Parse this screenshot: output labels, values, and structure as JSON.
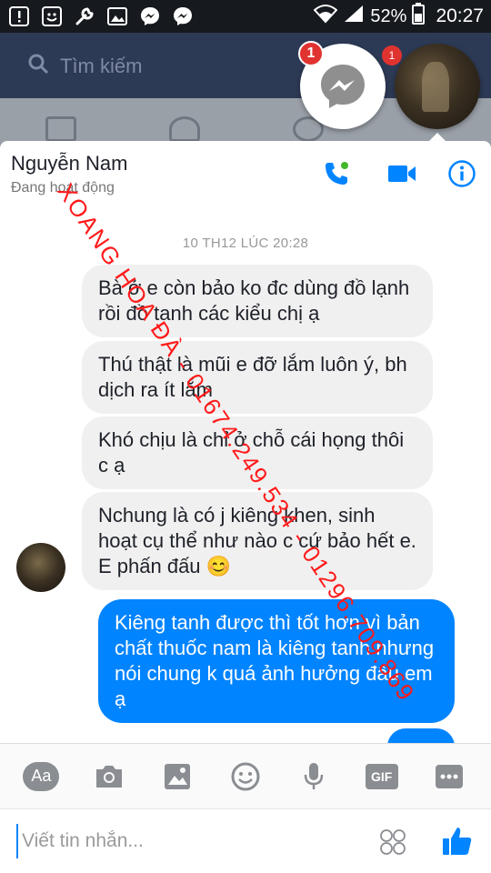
{
  "status_bar": {
    "battery": "52%",
    "time": "20:27"
  },
  "facebook": {
    "search_placeholder": "Tìm kiếm"
  },
  "chat_heads": {
    "messenger_badge": "1",
    "second_badge": "1"
  },
  "chat": {
    "contact_name": "Nguyễn Nam",
    "contact_status": "Đang hoạt động",
    "timestamp": "10 TH12 LÚC 20:28",
    "messages": [
      {
        "from": "them",
        "text": "Bà ở e còn bảo ko đc dùng đồ lạnh rồi đồ tanh các kiểu chị ạ"
      },
      {
        "from": "them",
        "text": "Thú thật là mũi e đỡ lắm luôn ý, bh dịch ra ít lắm"
      },
      {
        "from": "them",
        "text": "Khó chịu là chỉ ở chỗ cái họng thôi c ạ"
      },
      {
        "from": "them",
        "text": "Nchung là có j kiêng khen, sinh hoạt cụ thể như nào c cứ bảo hết e. E phấn đấu 😊"
      },
      {
        "from": "me",
        "text": "Kiêng tanh được thì tốt hơn vì bản chất thuốc nam là kiêng tanh nhưng nói chung k quá ảnh hưởng đâu em ạ"
      }
    ]
  },
  "watermark": "XOANG HOA ĐÀ - 01674.249.534 - 01296.709.869",
  "composer": {
    "aa_label": "Aa",
    "gif_label": "GIF",
    "input_placeholder": "Viết tin nhắn..."
  },
  "colors": {
    "accent": "#0084ff",
    "watermark": "#ff1a1a",
    "badge": "#e0332f"
  }
}
